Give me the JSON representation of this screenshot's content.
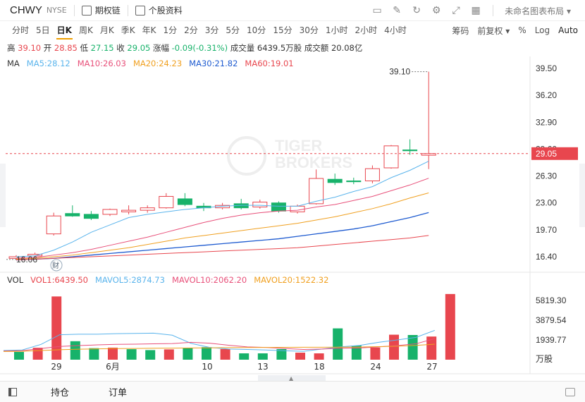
{
  "header": {
    "symbol": "CHWY",
    "exchange": "NYSE",
    "options_chain_label": "期权链",
    "stock_profile_label": "个股资料",
    "layout_label": "未命名图表布局"
  },
  "periods": [
    "分时",
    "5日",
    "日K",
    "周K",
    "月K",
    "季K",
    "年K",
    "1分",
    "2分",
    "3分",
    "5分",
    "10分",
    "15分",
    "30分",
    "1小时",
    "2小时",
    "4小时"
  ],
  "active_period": "日K",
  "options": {
    "indicators": "筹码",
    "adjust": "前复权",
    "percent": "%",
    "log": "Log",
    "auto": "Auto"
  },
  "ohlc": {
    "high_label": "高",
    "high": "39.10",
    "open_label": "开",
    "open": "28.85",
    "low_label": "低",
    "low": "27.15",
    "close_label": "收",
    "close": "29.05",
    "change_label": "涨幅",
    "change": "-0.09(-0.31%)",
    "volume_label": "成交量",
    "volume": "6439.5万股",
    "turnover_label": "成交额",
    "turnover": "20.08亿"
  },
  "ma": {
    "label": "MA",
    "items": [
      {
        "text": "MA5:28.12",
        "color": "#5ab4ec"
      },
      {
        "text": "MA10:26.03",
        "color": "#e8507a"
      },
      {
        "text": "MA20:24.23",
        "color": "#f0a020"
      },
      {
        "text": "MA30:21.82",
        "color": "#1e5bd0"
      },
      {
        "text": "MA60:19.01",
        "color": "#e8464e"
      }
    ]
  },
  "vol": {
    "label": "VOL",
    "items": [
      {
        "text": "VOL1:6439.50",
        "color": "#e8464e"
      },
      {
        "text": "MAVOL5:2874.73",
        "color": "#5ab4ec"
      },
      {
        "text": "MAVOL10:2062.20",
        "color": "#e8507a"
      },
      {
        "text": "MAVOL20:1522.32",
        "color": "#f0a020"
      }
    ]
  },
  "price_axis": [
    "39.50",
    "36.20",
    "32.90",
    "29.60",
    "26.30",
    "23.00",
    "19.70",
    "16.40"
  ],
  "current_price_tag": "29.05",
  "high_marker": "39.10",
  "low_marker": "16.06",
  "earnings_marker": "财",
  "watermark": [
    "TIGER",
    "BROKERS"
  ],
  "vol_axis": [
    "5819.30",
    "3879.54",
    "1939.77"
  ],
  "vol_unit": "万股",
  "date_labels": [
    "29",
    "6月",
    "10",
    "13",
    "18",
    "24",
    "27"
  ],
  "bottom": {
    "tab_positions": "持仓",
    "tab_orders": "订单"
  },
  "colors": {
    "up": "#e8464e",
    "down": "#17b26a",
    "accent": "#f0a000"
  },
  "chart_data": {
    "type": "candlestick",
    "ylim": [
      15.0,
      40.5
    ],
    "candles": [
      {
        "o": 16.2,
        "h": 16.6,
        "l": 16.06,
        "c": 16.4
      },
      {
        "o": 16.5,
        "h": 16.9,
        "l": 16.3,
        "c": 16.7
      },
      {
        "o": 19.2,
        "h": 21.8,
        "l": 19.0,
        "c": 21.4
      },
      {
        "o": 21.7,
        "h": 22.7,
        "l": 21.3,
        "c": 21.4
      },
      {
        "o": 21.6,
        "h": 22.0,
        "l": 20.9,
        "c": 21.1
      },
      {
        "o": 21.6,
        "h": 22.3,
        "l": 21.4,
        "c": 22.2
      },
      {
        "o": 21.9,
        "h": 22.7,
        "l": 21.6,
        "c": 22.1
      },
      {
        "o": 22.1,
        "h": 22.7,
        "l": 21.8,
        "c": 22.4
      },
      {
        "o": 22.4,
        "h": 24.2,
        "l": 22.3,
        "c": 23.8
      },
      {
        "o": 23.5,
        "h": 24.2,
        "l": 22.6,
        "c": 22.8
      },
      {
        "o": 22.6,
        "h": 23.0,
        "l": 22.0,
        "c": 22.4
      },
      {
        "o": 22.4,
        "h": 23.0,
        "l": 22.2,
        "c": 22.7
      },
      {
        "o": 22.9,
        "h": 23.5,
        "l": 22.2,
        "c": 22.4
      },
      {
        "o": 22.5,
        "h": 23.4,
        "l": 22.3,
        "c": 23.1
      },
      {
        "o": 23.0,
        "h": 23.2,
        "l": 21.8,
        "c": 22.0
      },
      {
        "o": 21.9,
        "h": 22.8,
        "l": 21.7,
        "c": 22.6
      },
      {
        "o": 22.9,
        "h": 27.1,
        "l": 22.8,
        "c": 26.0
      },
      {
        "o": 25.9,
        "h": 26.6,
        "l": 25.2,
        "c": 25.5
      },
      {
        "o": 25.7,
        "h": 26.1,
        "l": 25.3,
        "c": 25.6
      },
      {
        "o": 25.7,
        "h": 27.6,
        "l": 25.4,
        "c": 27.2
      },
      {
        "o": 27.3,
        "h": 30.1,
        "l": 27.2,
        "c": 30.0
      },
      {
        "o": 29.5,
        "h": 30.8,
        "l": 28.9,
        "c": 29.4
      },
      {
        "o": 28.85,
        "h": 39.1,
        "l": 27.15,
        "c": 29.05
      }
    ],
    "ma_lines": {
      "MA5": [
        16.4,
        16.5,
        17.2,
        18.2,
        19.4,
        20.3,
        21.2,
        21.6,
        21.9,
        22.2,
        22.4,
        22.6,
        22.7,
        22.7,
        22.6,
        22.6,
        23.2,
        23.7,
        24.4,
        25.0,
        26.1,
        27.0,
        28.12
      ],
      "MA10": [
        16.2,
        16.3,
        16.6,
        16.9,
        17.3,
        17.8,
        18.3,
        18.8,
        19.4,
        20.0,
        20.6,
        21.1,
        21.5,
        21.8,
        22.0,
        22.1,
        22.5,
        22.8,
        23.3,
        23.8,
        24.5,
        25.2,
        26.03
      ],
      "MA20": [
        16.1,
        16.2,
        16.4,
        16.6,
        16.9,
        17.2,
        17.5,
        17.9,
        18.3,
        18.7,
        19.0,
        19.3,
        19.6,
        19.9,
        20.2,
        20.5,
        20.9,
        21.3,
        21.8,
        22.3,
        22.9,
        23.6,
        24.23
      ],
      "MA30": [
        16.0,
        16.1,
        16.2,
        16.4,
        16.6,
        16.8,
        17.0,
        17.2,
        17.4,
        17.6,
        17.8,
        18.0,
        18.2,
        18.4,
        18.6,
        18.9,
        19.2,
        19.5,
        19.8,
        20.2,
        20.7,
        21.2,
        21.82
      ],
      "MA60": [
        16.0,
        16.1,
        16.2,
        16.3,
        16.4,
        16.5,
        16.6,
        16.7,
        16.8,
        16.9,
        17.0,
        17.1,
        17.2,
        17.3,
        17.4,
        17.5,
        17.7,
        17.9,
        18.1,
        18.3,
        18.5,
        18.7,
        19.01
      ]
    },
    "volume": {
      "ylim": [
        0,
        6500
      ],
      "values": [
        760,
        1170,
        6200,
        1810,
        1130,
        1180,
        1030,
        940,
        1010,
        1170,
        1230,
        1040,
        620,
        620,
        1040,
        690,
        620,
        3070,
        1380,
        1190,
        2450,
        2420,
        2270,
        6439.5
      ],
      "mavol5": [
        900,
        950,
        1500,
        2450,
        2500,
        2500,
        2550,
        2580,
        2600,
        2400,
        1600,
        1200,
        1050,
        1000,
        950,
        870,
        820,
        1050,
        1260,
        1400,
        1700,
        1940,
        2190,
        2874.73
      ],
      "mavol10": [
        850,
        880,
        1100,
        1300,
        1380,
        1450,
        1500,
        1520,
        1560,
        1580,
        1700,
        1620,
        1420,
        1250,
        1200,
        1100,
        1000,
        1050,
        1120,
        1150,
        1250,
        1380,
        1560,
        2062.2
      ],
      "mavol20": [
        800,
        820,
        900,
        980,
        1030,
        1060,
        1090,
        1100,
        1120,
        1130,
        1150,
        1160,
        1180,
        1190,
        1200,
        1210,
        1215,
        1220,
        1230,
        1240,
        1280,
        1320,
        1400,
        1522.32
      ]
    }
  }
}
